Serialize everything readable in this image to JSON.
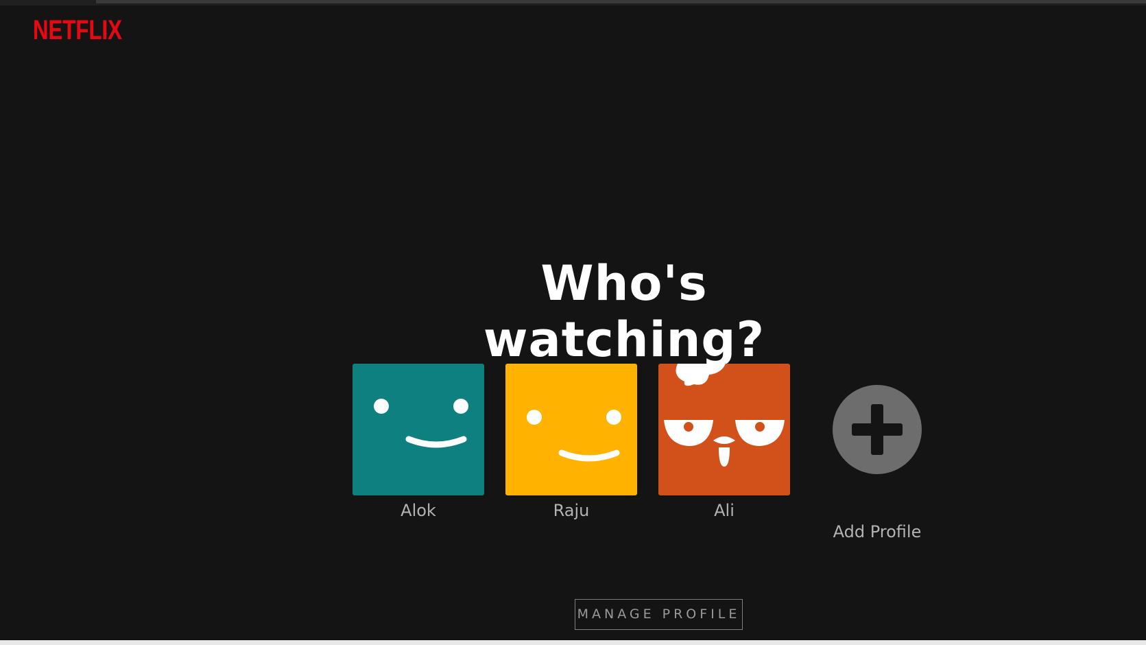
{
  "brand": {
    "logo_text": "NETFLIX",
    "color": "#e50914"
  },
  "heading": "Who's watching?",
  "profiles": [
    {
      "name": "Alok",
      "avatar_color": "#0f8080",
      "avatar_icon": "smiley-face-icon"
    },
    {
      "name": "Raju",
      "avatar_color": "#ffb200",
      "avatar_icon": "smiley-face-icon"
    },
    {
      "name": "Ali",
      "avatar_color": "#d2511a",
      "avatar_icon": "chicken-face-icon"
    }
  ],
  "add_profile": {
    "label": "Add Profile",
    "icon": "plus-icon"
  },
  "manage_button": "MANAGE PROFILE",
  "colors": {
    "background": "#141414",
    "profile_name": "#b3b3b3"
  }
}
